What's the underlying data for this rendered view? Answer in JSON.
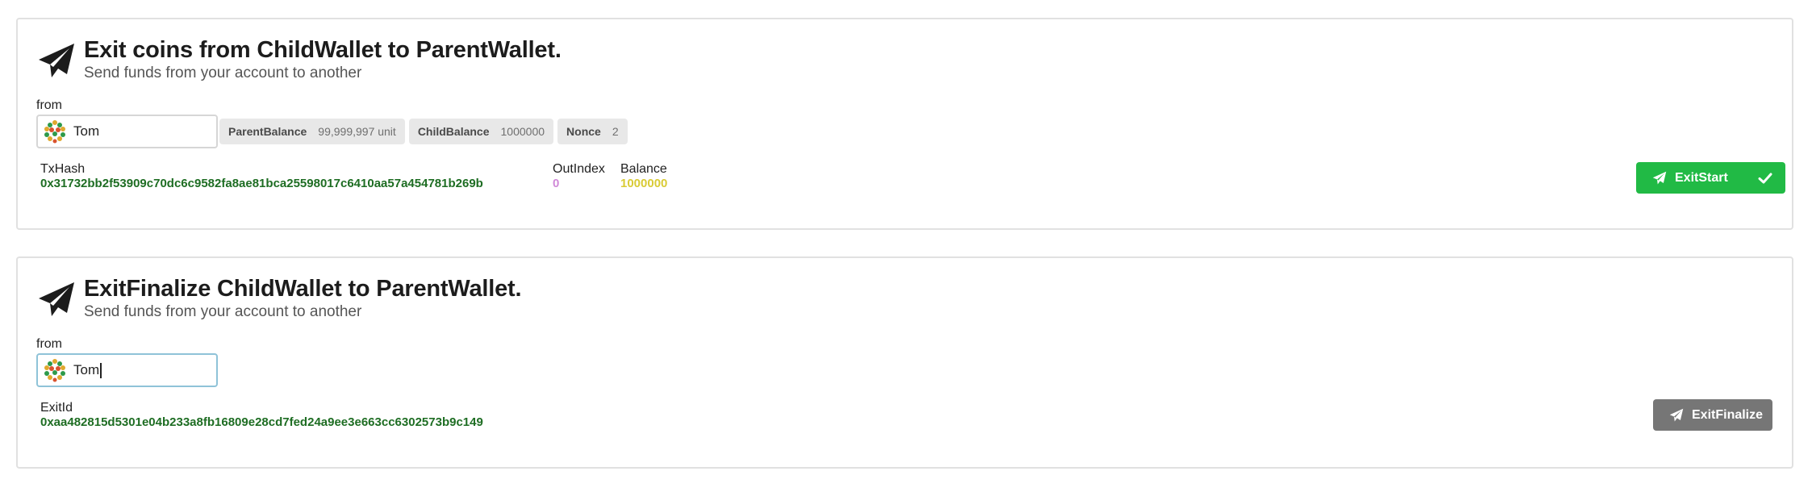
{
  "exit_start": {
    "title": "Exit coins from ChildWallet to ParentWallet.",
    "subtitle": "Send funds from your account to another",
    "from_label": "from",
    "from_value": "Tom",
    "labels": [
      {
        "key": "ParentBalance",
        "value": "99,999,997 unit"
      },
      {
        "key": "ChildBalance",
        "value": "1000000"
      },
      {
        "key": "Nonce",
        "value": "2"
      }
    ],
    "txhash_label": "TxHash",
    "txhash_value": "0x31732bb2f53909c70dc6c9582fa8ae81bca25598017c6410aa57a454781b269b",
    "outindex_label": "OutIndex",
    "outindex_value": "0",
    "balance_label": "Balance",
    "balance_value": "1000000",
    "button_label": "ExitStart",
    "button_color": "#21ba45"
  },
  "exit_finalize": {
    "title": "ExitFinalize ChildWallet to ParentWallet.",
    "subtitle": "Send funds from your account to another",
    "from_label": "from",
    "from_value": "Tom",
    "exitid_label": "ExitId",
    "exitid_value": "0xaa482815d5301e04b233a8fb16809e28cd7fed24a9ee3e663cc6302573b9c149",
    "button_label": "ExitFinalize",
    "button_color": "#767676"
  },
  "icons": {
    "header": "paper-plane-icon",
    "button": "paper-plane-icon",
    "confirm": "check-icon",
    "avatar": "identicon-avatar"
  }
}
